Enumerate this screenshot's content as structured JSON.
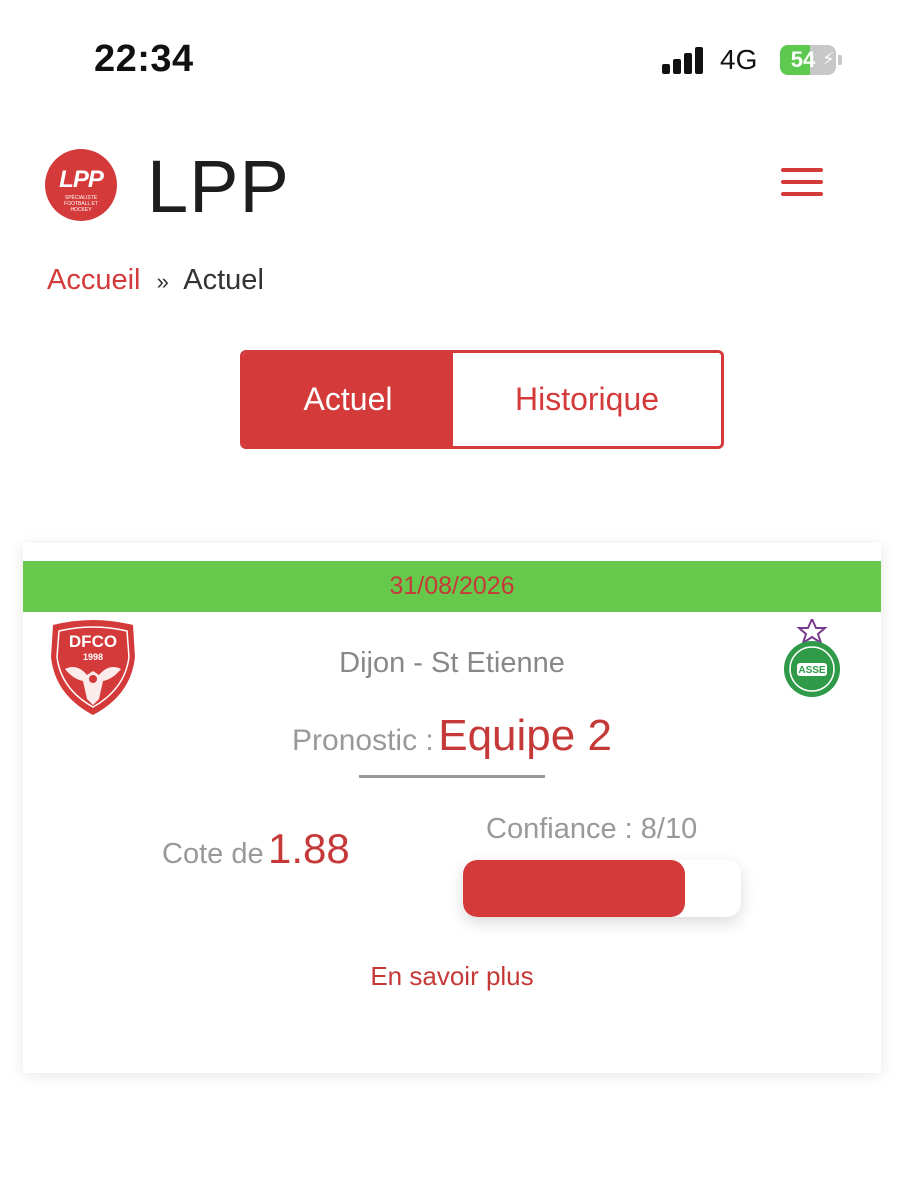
{
  "status_bar": {
    "time": "22:34",
    "network": "4G",
    "battery_level": "54",
    "battery_percent": 54,
    "battery_icon": "charging-bolt-icon"
  },
  "header": {
    "logo_text": "LPP",
    "logo_subtext": "SPÉCIALISTE FOOTBALL ET HOCKEY",
    "title": "LPP",
    "menu_icon": "hamburger-menu-icon"
  },
  "breadcrumb": {
    "home": "Accueil",
    "separator": "»",
    "current": "Actuel"
  },
  "tabs": [
    {
      "label": "Actuel",
      "active": true
    },
    {
      "label": "Historique",
      "active": false
    }
  ],
  "match": {
    "date": "31/08/2026",
    "home_logo": {
      "icon": "dfco-crest",
      "text": "DFCO",
      "year": "1998"
    },
    "away_logo": {
      "icon": "asse-crest",
      "text": "ASSE"
    },
    "teams": "Dijon - St Etienne",
    "prono_label": "Pronostic :",
    "prono_value": "Equipe 2",
    "cote_label": "Cote de",
    "cote_value": "1.88",
    "confiance_label": "Confiance : 8/10",
    "confiance_fraction": 0.8,
    "more_link": "En savoir plus"
  },
  "colors": {
    "brand_red": "#d43a3a",
    "date_green": "#67c94b",
    "muted_gray": "#999999"
  }
}
